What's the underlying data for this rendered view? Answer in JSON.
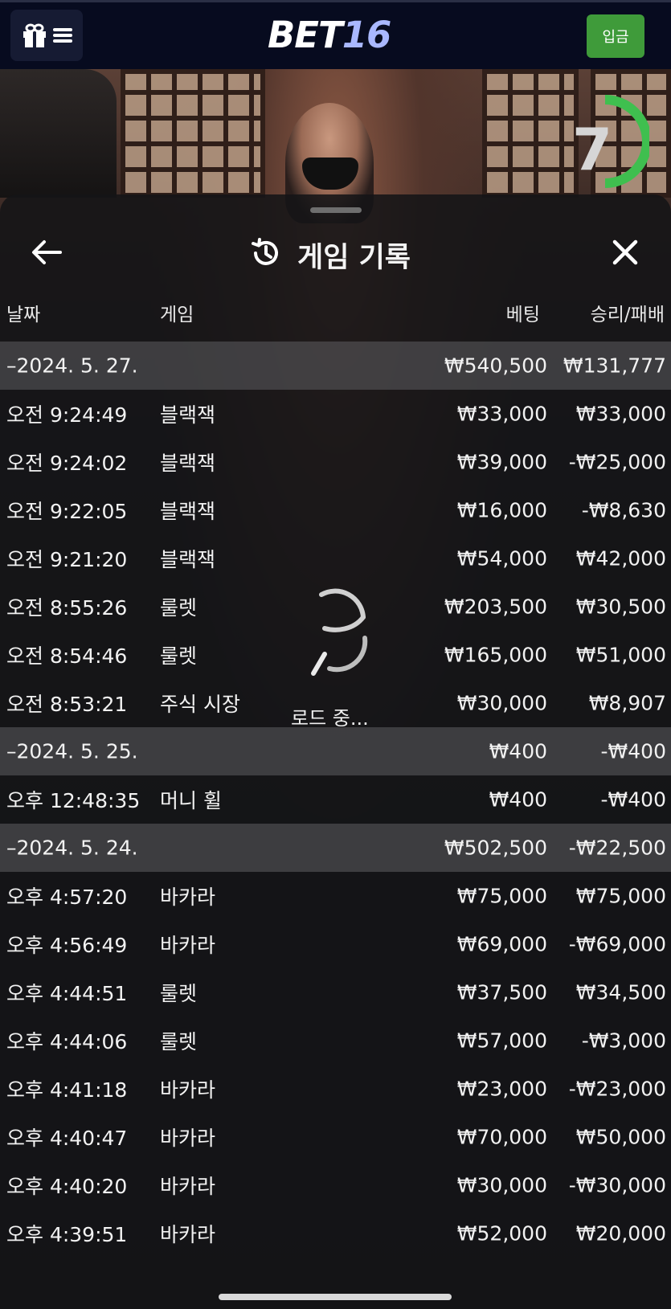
{
  "topbar": {
    "logo_part1": "BET",
    "logo_part2": "16",
    "deposit_label": "입금",
    "icons": [
      "gift-icon",
      "menu-icon"
    ]
  },
  "video": {
    "timer_value": "7",
    "timer_color": "#3fbf4f"
  },
  "sheet": {
    "title": "게임 기록",
    "icons": [
      "back-arrow-icon",
      "history-icon",
      "close-icon"
    ],
    "columns": {
      "date": "날짜",
      "game": "게임",
      "bet": "베팅",
      "result": "승리/패배"
    },
    "loading_text": "로드 중...",
    "groups": [
      {
        "date": "–2024. 5. 27.",
        "bet_total": "₩540,500",
        "result_total": "₩131,777",
        "rows": [
          {
            "time": "오전 9:24:49",
            "game": "블랙잭",
            "bet": "₩33,000",
            "result": "₩33,000"
          },
          {
            "time": "오전 9:24:02",
            "game": "블랙잭",
            "bet": "₩39,000",
            "result": "-₩25,000"
          },
          {
            "time": "오전 9:22:05",
            "game": "블랙잭",
            "bet": "₩16,000",
            "result": "-₩8,630"
          },
          {
            "time": "오전 9:21:20",
            "game": "블랙잭",
            "bet": "₩54,000",
            "result": "₩42,000"
          },
          {
            "time": "오전 8:55:26",
            "game": "룰렛",
            "bet": "₩203,500",
            "result": "₩30,500"
          },
          {
            "time": "오전 8:54:46",
            "game": "룰렛",
            "bet": "₩165,000",
            "result": "₩51,000"
          },
          {
            "time": "오전 8:53:21",
            "game": "주식 시장",
            "bet": "₩30,000",
            "result": "₩8,907"
          }
        ]
      },
      {
        "date": "–2024. 5. 25.",
        "bet_total": "₩400",
        "result_total": "-₩400",
        "rows": [
          {
            "time": "오후 12:48:35",
            "game": "머니 휠",
            "bet": "₩400",
            "result": "-₩400"
          }
        ]
      },
      {
        "date": "–2024. 5. 24.",
        "bet_total": "₩502,500",
        "result_total": "-₩22,500",
        "rows": [
          {
            "time": "오후 4:57:20",
            "game": "바카라",
            "bet": "₩75,000",
            "result": "₩75,000"
          },
          {
            "time": "오후 4:56:49",
            "game": "바카라",
            "bet": "₩69,000",
            "result": "-₩69,000"
          },
          {
            "time": "오후 4:44:51",
            "game": "룰렛",
            "bet": "₩37,500",
            "result": "₩34,500"
          },
          {
            "time": "오후 4:44:06",
            "game": "룰렛",
            "bet": "₩57,000",
            "result": "-₩3,000"
          },
          {
            "time": "오후 4:41:18",
            "game": "바카라",
            "bet": "₩23,000",
            "result": "-₩23,000"
          },
          {
            "time": "오후 4:40:47",
            "game": "바카라",
            "bet": "₩70,000",
            "result": "₩50,000"
          },
          {
            "time": "오후 4:40:20",
            "game": "바카라",
            "bet": "₩30,000",
            "result": "-₩30,000"
          },
          {
            "time": "오후 4:39:51",
            "game": "바카라",
            "bet": "₩52,000",
            "result": "₩20,000"
          }
        ]
      }
    ]
  }
}
